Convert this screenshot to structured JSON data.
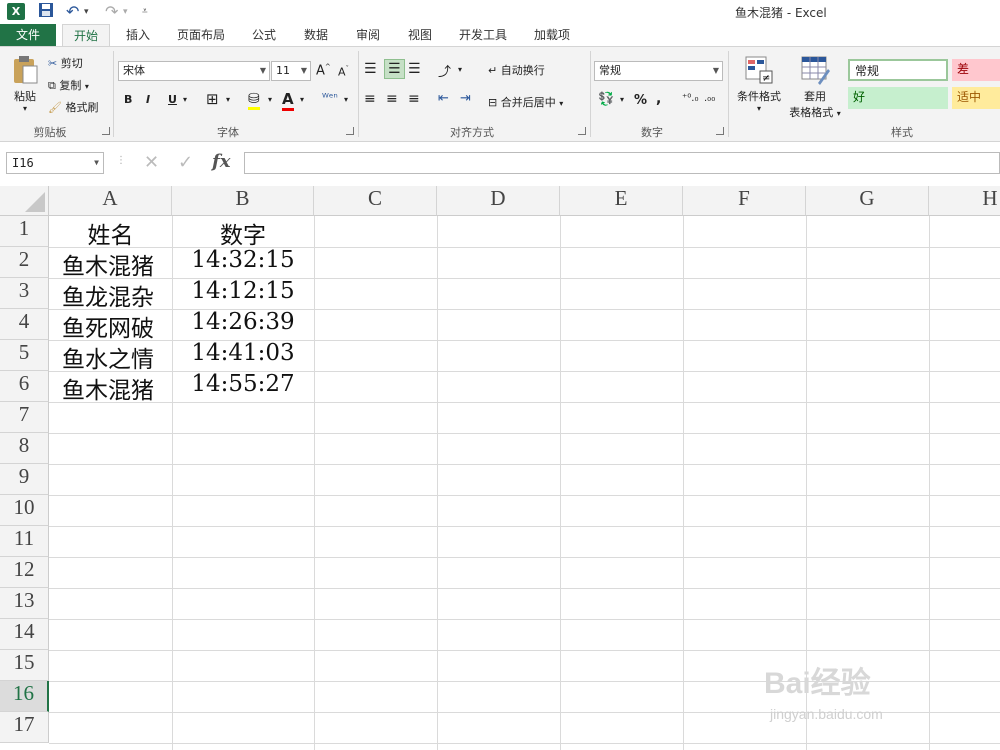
{
  "window": {
    "title": "鱼木混猪 - Excel",
    "app_icon": "excel-icon",
    "quick_access": [
      "save-icon",
      "undo-icon",
      "redo-icon",
      "customize-icon"
    ]
  },
  "tabs": [
    {
      "label": "文件"
    },
    {
      "label": "开始"
    },
    {
      "label": "插入"
    },
    {
      "label": "页面布局"
    },
    {
      "label": "公式"
    },
    {
      "label": "数据"
    },
    {
      "label": "审阅"
    },
    {
      "label": "视图"
    },
    {
      "label": "开发工具"
    },
    {
      "label": "加载项"
    }
  ],
  "active_tab": "开始",
  "ribbon": {
    "clipboard": {
      "group": "剪贴板",
      "paste": "粘贴",
      "cut": "剪切",
      "copy": "复制",
      "format_painter": "格式刷"
    },
    "font": {
      "group": "字体",
      "font_name": "宋体",
      "font_size": "11",
      "bold": "B",
      "italic": "I",
      "underline": "U"
    },
    "alignment": {
      "group": "对齐方式",
      "wrap_text": "自动换行",
      "merge_center": "合并后居中"
    },
    "number": {
      "group": "数字",
      "format": "常规",
      "percent": "%",
      "comma": ","
    },
    "styles_group": {
      "group": "样式",
      "conditional": "条件格式",
      "table_line1": "套用",
      "table_line2": "表格格式",
      "cell_styles": [
        {
          "label": "常规",
          "color": "#ffffff"
        },
        {
          "label": "差",
          "color": "#ffc7ce"
        },
        {
          "label": "好",
          "color": "#c6efce"
        },
        {
          "label": "适中",
          "color": "#ffeb9c"
        }
      ]
    }
  },
  "formula_bar": {
    "name_box": "I16",
    "cancel": "✕",
    "enter": "✓",
    "fx": "fx",
    "value": ""
  },
  "sheet": {
    "columns": [
      "A",
      "B",
      "C",
      "D",
      "E",
      "F",
      "G",
      "H"
    ],
    "rows": [
      "1",
      "2",
      "3",
      "4",
      "5",
      "6",
      "7",
      "8",
      "9",
      "10",
      "11",
      "12",
      "13",
      "14",
      "15",
      "16",
      "17"
    ],
    "selected_row": "16",
    "cells": [
      [
        "姓名",
        "数字"
      ],
      [
        "鱼木混猪",
        "14:32:15"
      ],
      [
        "鱼龙混杂",
        "14:12:15"
      ],
      [
        "鱼死网破",
        "14:26:39"
      ],
      [
        "鱼水之情",
        "14:41:03"
      ],
      [
        "鱼木混猪",
        "14:55:27"
      ]
    ]
  },
  "watermark": {
    "logo": "Bai经验",
    "url": "jingyan.baidu.com"
  },
  "colors": {
    "accent": "#217346"
  }
}
